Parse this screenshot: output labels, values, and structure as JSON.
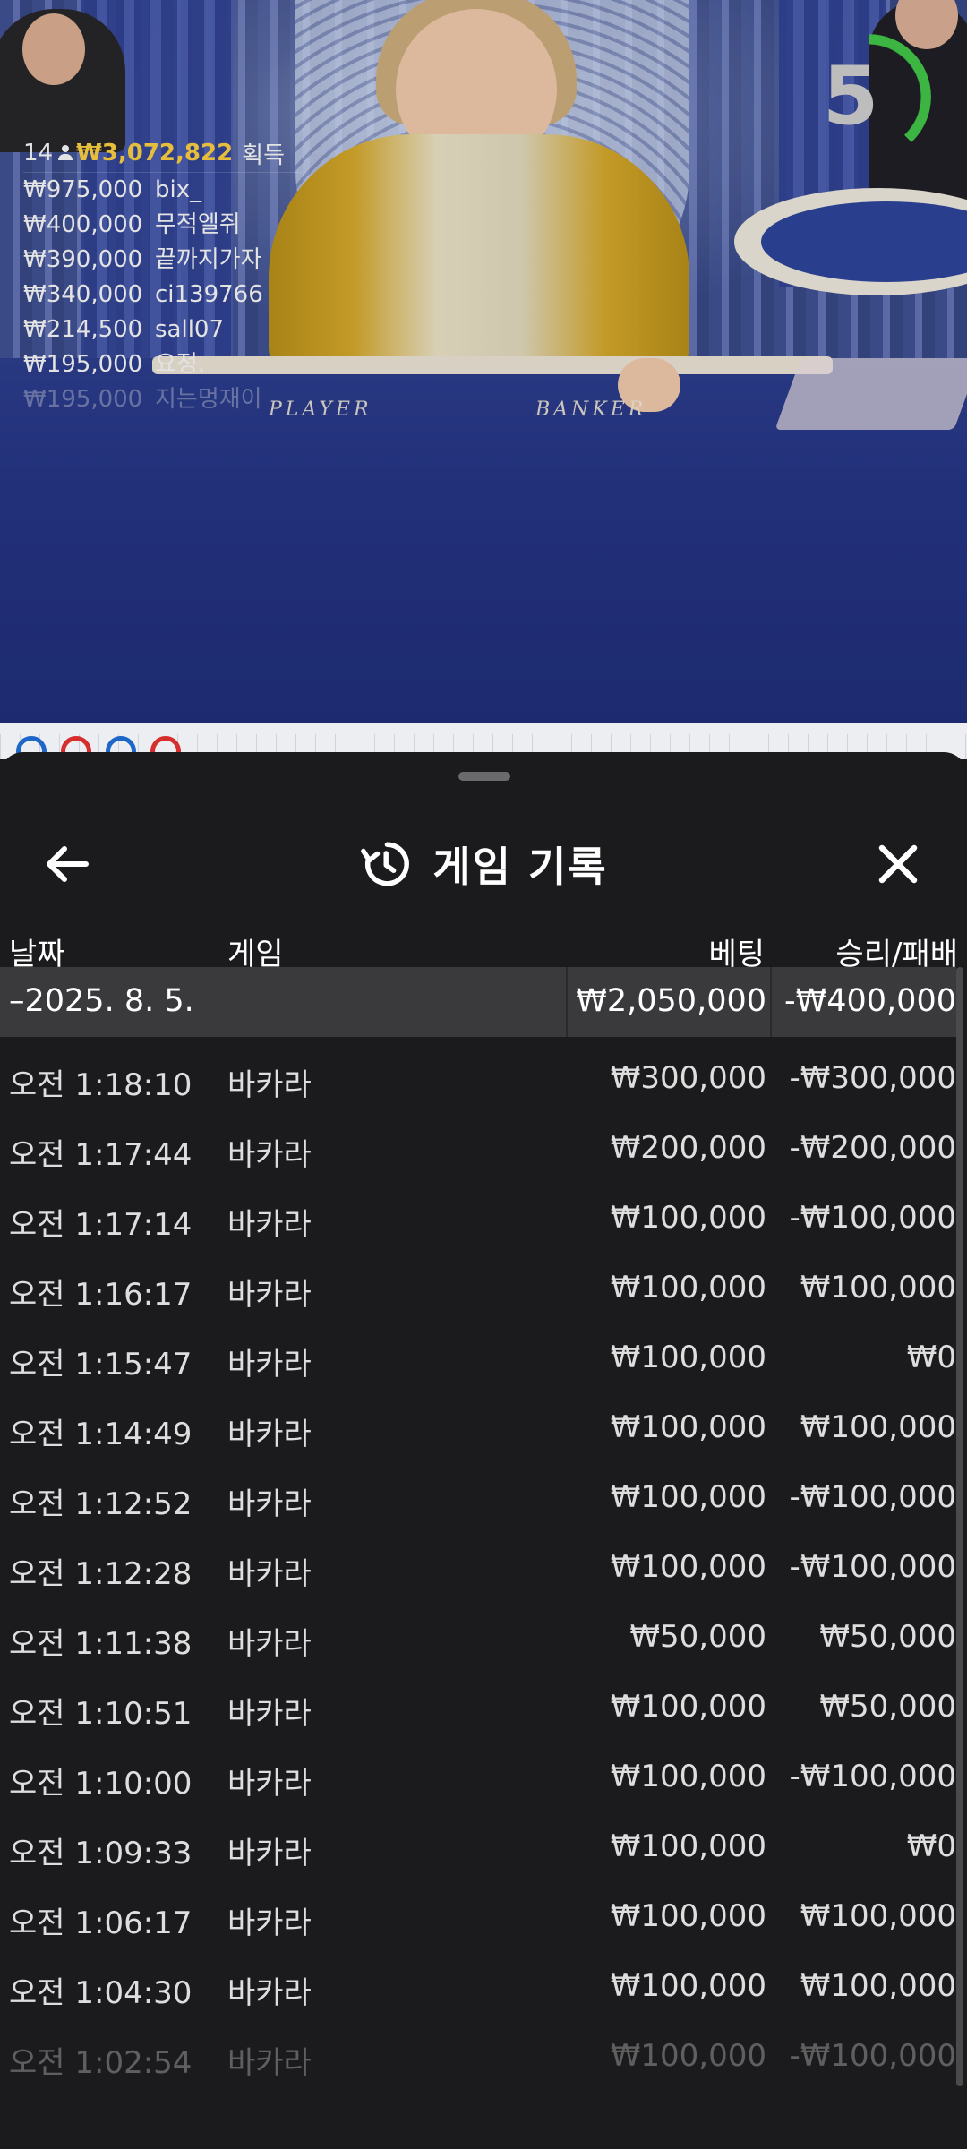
{
  "video": {
    "bet_labels": {
      "player": "PLAYER",
      "banker": "BANKER"
    },
    "countdown": {
      "value": "5",
      "remaining_fraction": 0.38,
      "ring_color": "#3cb543"
    }
  },
  "winners": {
    "count": "14",
    "total": "₩3,072,822",
    "total_label": "획득",
    "list": [
      {
        "amount": "₩975,000",
        "name": "bix_"
      },
      {
        "amount": "₩400,000",
        "name": "무적엘쥐"
      },
      {
        "amount": "₩390,000",
        "name": "끝까지가자"
      },
      {
        "amount": "₩340,000",
        "name": "ci139766"
      },
      {
        "amount": "₩214,500",
        "name": "sall07"
      },
      {
        "amount": "₩195,000",
        "name": "요정."
      },
      {
        "amount": "₩195,000",
        "name": "지는멍재이"
      }
    ]
  },
  "history": {
    "title": "게임 기록",
    "icons": {
      "back": "arrow-left-icon",
      "title": "history-clock-icon",
      "close": "close-icon"
    },
    "columns": {
      "date": "날짜",
      "game": "게임",
      "bet": "베팅",
      "win_loss": "승리/패배"
    },
    "day": {
      "date": "–2025. 8. 5.",
      "bet": "₩2,050,000",
      "win_loss": "-₩400,000"
    },
    "rows": [
      {
        "time": "오전 1:18:10",
        "game": "바카라",
        "bet": "₩300,000",
        "win_loss": "-₩300,000"
      },
      {
        "time": "오전 1:17:44",
        "game": "바카라",
        "bet": "₩200,000",
        "win_loss": "-₩200,000"
      },
      {
        "time": "오전 1:17:14",
        "game": "바카라",
        "bet": "₩100,000",
        "win_loss": "-₩100,000"
      },
      {
        "time": "오전 1:16:17",
        "game": "바카라",
        "bet": "₩100,000",
        "win_loss": "₩100,000"
      },
      {
        "time": "오전 1:15:47",
        "game": "바카라",
        "bet": "₩100,000",
        "win_loss": "₩0"
      },
      {
        "time": "오전 1:14:49",
        "game": "바카라",
        "bet": "₩100,000",
        "win_loss": "₩100,000"
      },
      {
        "time": "오전 1:12:52",
        "game": "바카라",
        "bet": "₩100,000",
        "win_loss": "-₩100,000"
      },
      {
        "time": "오전 1:12:28",
        "game": "바카라",
        "bet": "₩100,000",
        "win_loss": "-₩100,000"
      },
      {
        "time": "오전 1:11:38",
        "game": "바카라",
        "bet": "₩50,000",
        "win_loss": "₩50,000"
      },
      {
        "time": "오전 1:10:51",
        "game": "바카라",
        "bet": "₩100,000",
        "win_loss": "₩50,000"
      },
      {
        "time": "오전 1:10:00",
        "game": "바카라",
        "bet": "₩100,000",
        "win_loss": "-₩100,000"
      },
      {
        "time": "오전 1:09:33",
        "game": "바카라",
        "bet": "₩100,000",
        "win_loss": "₩0"
      },
      {
        "time": "오전 1:06:17",
        "game": "바카라",
        "bet": "₩100,000",
        "win_loss": "₩100,000"
      },
      {
        "time": "오전 1:04:30",
        "game": "바카라",
        "bet": "₩100,000",
        "win_loss": "₩100,000"
      },
      {
        "time": "오전 1:02:54",
        "game": "바카라",
        "bet": "₩100,000",
        "win_loss": "-₩100,000"
      }
    ]
  },
  "scoreboard": {
    "beads": [
      "#1e66c8",
      "#d62d2d",
      "#1e66c8",
      "#d62d2d"
    ]
  }
}
